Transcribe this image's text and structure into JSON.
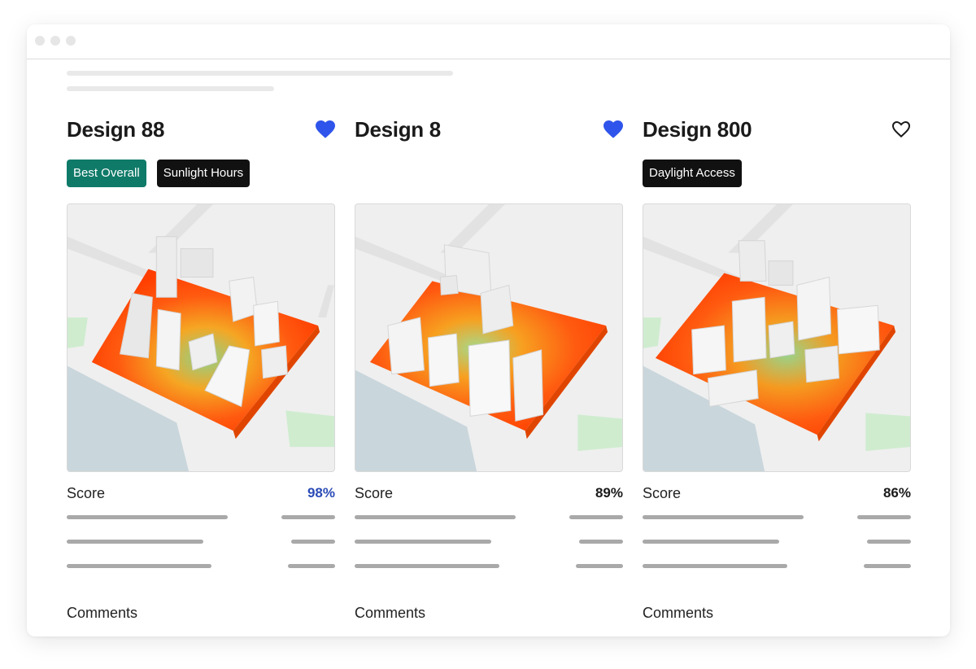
{
  "colors": {
    "favorite_active": "#2f54eb",
    "best_overall_tag": "#0f7a68",
    "tag_dark": "#111111",
    "score_highlight": "#2b4bb6",
    "heat_hot": "#ff4f00",
    "heat_cool": "#7ecb8a",
    "water": "#c9d6dc",
    "park": "#cfeccf"
  },
  "designs": [
    {
      "title": "Design 88",
      "favorited": true,
      "tags": [
        {
          "label": "Best Overall",
          "style": "green"
        },
        {
          "label": "Sunlight Hours",
          "style": "black"
        }
      ],
      "score_label": "Score",
      "score": "98%",
      "score_highlight": true,
      "comments_label": "Comments"
    },
    {
      "title": "Design 8",
      "favorited": true,
      "tags": [],
      "score_label": "Score",
      "score": "89%",
      "score_highlight": false,
      "comments_label": "Comments"
    },
    {
      "title": "Design 800",
      "favorited": false,
      "tags": [
        {
          "label": "Daylight Access",
          "style": "black"
        }
      ],
      "score_label": "Score",
      "score": "86%",
      "score_highlight": false,
      "comments_label": "Comments"
    }
  ]
}
